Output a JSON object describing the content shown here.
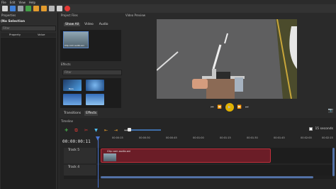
{
  "menubar": [
    "File",
    "Edit",
    "View",
    "Help"
  ],
  "props": {
    "title": "Properties",
    "selection": "(No Selection",
    "filter_placeholder": "Filter",
    "col_property": "Property",
    "col_value": "Value"
  },
  "project_files": {
    "title": "Project Files",
    "tabs": [
      "Show All",
      "Video",
      "Audio"
    ],
    "file_label": "Clip com audio.avi"
  },
  "effects": {
    "title": "Effects",
    "filter_placeholder": "Filter",
    "items": [
      "Bars",
      "",
      "",
      ""
    ],
    "tabs": [
      "Transitions",
      "Effects"
    ]
  },
  "video_preview": {
    "title": "Video Preview"
  },
  "timeline": {
    "title": "Timeline",
    "timecode": "00:00:00:11",
    "seconds_label": "15 seconds",
    "ruler_ticks": [
      "00:00:15",
      "00:00:30",
      "00:00:45",
      "00:01:00",
      "00:01:15",
      "00:01:30",
      "00:01:45",
      "00:02:00",
      "00:02:15"
    ],
    "tracks": [
      {
        "name": "Track 5",
        "clip": "Clip com audio.avi"
      },
      {
        "name": "Track 4",
        "clip": ""
      }
    ]
  },
  "colors": {
    "accent": "#4a74d1",
    "clip": "#6b1d27",
    "clip_border": "#c0303c",
    "play": "#e0b100"
  }
}
